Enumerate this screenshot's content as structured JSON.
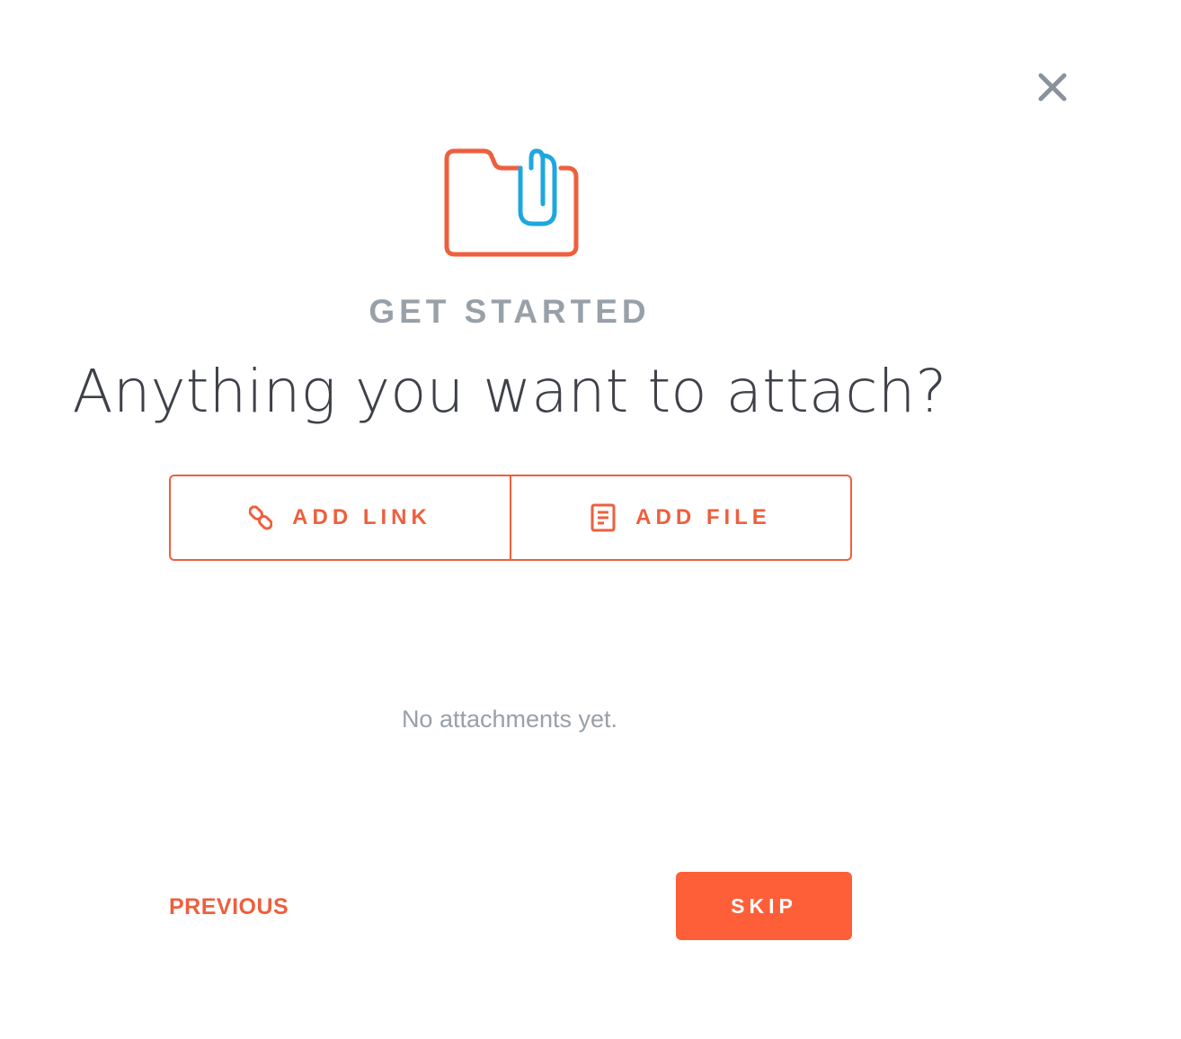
{
  "dialog": {
    "close_icon": "close-icon",
    "hero_icon": "folder-paperclip-icon",
    "eyebrow": "GET STARTED",
    "headline": "Anything you want to attach?",
    "actions": {
      "add_link": {
        "label": "ADD LINK",
        "icon": "link-icon"
      },
      "add_file": {
        "label": "ADD FILE",
        "icon": "document-icon"
      }
    },
    "empty_state": "No attachments yet.",
    "footer": {
      "previous_label": "PREVIOUS",
      "skip_label": "SKIP"
    }
  },
  "colors": {
    "accent": "#ee5f3d",
    "primary_button": "#ff5f38",
    "clip": "#1ea7df",
    "muted_text": "#98a0a8",
    "headline_text": "#3e4148",
    "close_icon": "#8a939b"
  }
}
